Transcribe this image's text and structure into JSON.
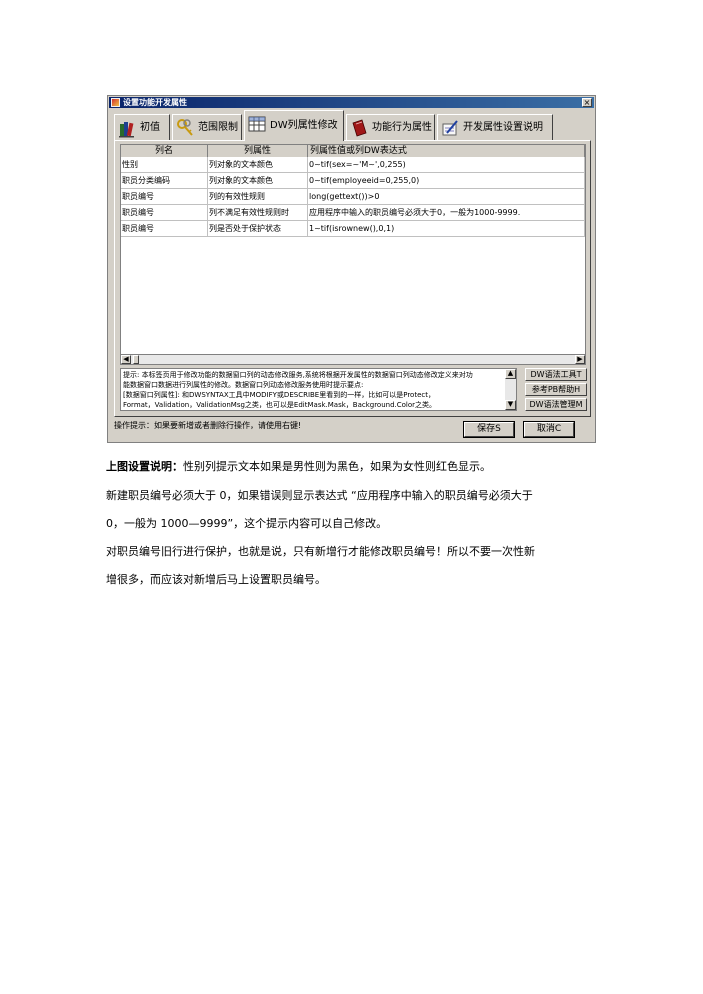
{
  "dialog": {
    "title": "设置功能开发属性",
    "close_label": "×",
    "tabs": [
      {
        "label": "初值",
        "icon": "books-icon"
      },
      {
        "label": "范围限制",
        "icon": "keys-icon"
      },
      {
        "label": "DW列属性修改",
        "icon": "grid-icon"
      },
      {
        "label": "功能行为属性",
        "icon": "red-book-icon"
      },
      {
        "label": "开发属性设置说明",
        "icon": "pen-paper-icon"
      }
    ],
    "grid": {
      "columns": [
        "列名",
        "列属性",
        "列属性值或列DW表达式"
      ],
      "rows": [
        [
          "性别",
          "列对象的文本颜色",
          "0~tif(sex=~'M~',0,255)"
        ],
        [
          "职员分类编码",
          "列对象的文本颜色",
          "0~tif(employeeid=0,255,0)"
        ],
        [
          "职员编号",
          "列的有效性规则",
          "long(gettext())>0"
        ],
        [
          "职员编号",
          "列不满足有效性规则时",
          "应用程序中输入的职员编号必须大于0，一般为1000-9999."
        ],
        [
          "职员编号",
          "列是否处于保护状态",
          "1~tif(isrownew(),0,1)"
        ]
      ]
    },
    "hint_lines": [
      "提示: 本标签页用于修改功能的数据窗口列的动态修改服务,系统将根据开发属性的数据窗口列动态修改定义来对功",
      "能数据窗口数据进行列属性的修改。数据窗口列动态修改服务使用时提示要点:",
      "[数据窗口列属性]: 和DWSYNTAX工具中MODIFY或DESCRIBE里看到的一样，比如可以是Protect，",
      "Format，Validation，ValidationMsg之类，也可以是EditMask.Mask，Background.Color之类。"
    ],
    "side_buttons": [
      "DW语法工具T",
      "参考PB帮助H",
      "DW语法管理M"
    ],
    "operation_hint": "操作提示：如果要新增或者删除行操作，请使用右键!",
    "save_label": "保存S",
    "cancel_label": "取消C"
  },
  "doc": {
    "caption_bold": "上图设置说明：",
    "caption_text": "性别列提示文本如果是男性则为黑色，如果为女性则红色显示。",
    "line2": "新建职员编号必须大于  0，如果错误则显示表达式 “应用程序中输入的职员编号必须大于",
    "line3": "0，一般为 1000—9999”，这个提示内容可以自己修改。",
    "line4": "对职员编号旧行进行保护，也就是说，只有新增行才能修改职员编号！所以不要一次性新",
    "line5": "增很多，而应该对新增后马上设置职员编号。"
  }
}
